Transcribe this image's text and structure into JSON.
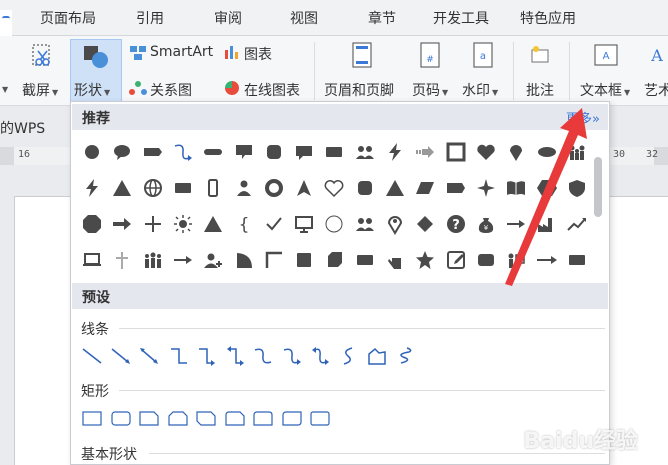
{
  "tabs": [
    "页面布局",
    "引用",
    "审阅",
    "视图",
    "章节",
    "开发工具",
    "特色应用"
  ],
  "ribbon": {
    "screenshot": "截屏",
    "shapes": "形状",
    "smartart": "SmartArt",
    "chart": "图表",
    "relation": "关系图",
    "online_chart": "在线图表",
    "header_footer": "页眉和页脚",
    "page_number": "页码",
    "watermark": "水印",
    "comment": "批注",
    "textbox": "文本框",
    "art": "艺术"
  },
  "document": {
    "wps_label": "的WPS",
    "ruler_left": "16",
    "ruler_right_1": "30",
    "ruler_right_2": "32"
  },
  "panel": {
    "recommended": "推荐",
    "more": "更多»",
    "presets": "预设",
    "lines": "线条",
    "rectangles": "矩形",
    "basic_shapes": "基本形状"
  },
  "recommended_icons": [
    [
      "circle-icon",
      "speech-bubble-icon",
      "tag-icon",
      "curved-arrow-icon",
      "rounded-bar-icon",
      "callout-icon",
      "rounded-square-icon",
      "chat-icon",
      "rect-icon",
      "people-icon",
      "lightning-icon",
      "striped-arrow-icon",
      "frame-icon",
      "heart-icon",
      "pin-icon",
      "ellipse-icon",
      "family-icon"
    ],
    [
      "lightning-icon",
      "triangle-icon",
      "globe-icon",
      "rect-icon",
      "phone-icon",
      "person-icon",
      "ring-icon",
      "navigate-icon",
      "heart-outline-icon",
      "rounded-square-icon",
      "triangle-icon",
      "parallelogram-icon",
      "tab-icon",
      "four-point-star-icon",
      "book-icon",
      "hexagon-icon",
      "shield-icon"
    ],
    [
      "octagon-icon",
      "right-arrow-icon",
      "plus-icon",
      "sun-icon",
      "triangle-icon",
      "brace-icon",
      "check-icon",
      "monitor-icon",
      "circle-outline-icon",
      "people-icon",
      "location-icon",
      "diamond-icon",
      "question-icon",
      "money-bag-icon",
      "arrow-icon",
      "factory-icon",
      "trend-icon"
    ],
    [
      "laptop-icon",
      "cross-icon",
      "group-icon",
      "arrow-icon",
      "add-user-icon",
      "moon-shape-icon",
      "corner-icon",
      "square-icon",
      "cube-icon",
      "rect-icon",
      "hand-icon",
      "star-icon",
      "edit-icon",
      "rounded-rect-icon",
      "presenter-icon",
      "long-arrow-icon",
      "rect-icon"
    ]
  ],
  "line_icons": [
    "line-icon",
    "arrow-line-icon",
    "double-arrow-line-icon",
    "elbow-connector-icon",
    "elbow-arrow-icon",
    "elbow-double-arrow-icon",
    "curved-connector-icon",
    "curved-arrow-icon",
    "curved-double-arrow-icon",
    "curve-icon",
    "freeform-icon",
    "scribble-icon"
  ],
  "rect_icons": [
    "rectangle-icon",
    "rounded-rectangle-icon",
    "snip-corner-icon",
    "snip-same-side-icon",
    "snip-diagonal-icon",
    "round-snip-icon",
    "round-same-side-icon",
    "round-diagonal-icon",
    "rounded-corner-rect-icon"
  ],
  "watermark_text": "Baidu经验",
  "colors": {
    "accent": "#3b78d8",
    "arrow": "#e83a3a",
    "shape_fill": "#4a4a4a"
  }
}
